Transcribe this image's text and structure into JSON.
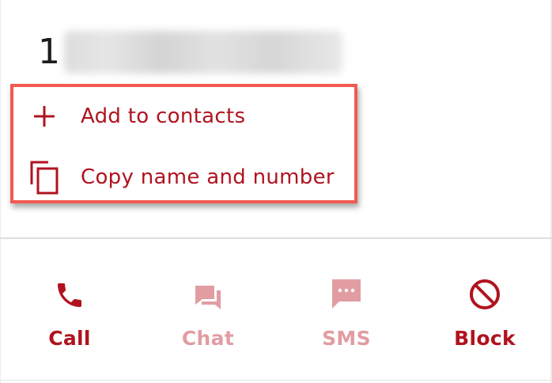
{
  "contact": {
    "number_prefix": "1"
  },
  "menu": {
    "add_to_contacts": "Add to contacts",
    "copy_name_number": "Copy name and number"
  },
  "actions": [
    {
      "label": "Call",
      "icon": "phone-icon",
      "enabled": true
    },
    {
      "label": "Chat",
      "icon": "chat-icon",
      "enabled": false
    },
    {
      "label": "SMS",
      "icon": "sms-icon",
      "enabled": false
    },
    {
      "label": "Block",
      "icon": "block-icon",
      "enabled": true
    }
  ],
  "colors": {
    "accent": "#b0131f",
    "accent_disabled": "#e19da2",
    "highlight": "#f25a51"
  }
}
